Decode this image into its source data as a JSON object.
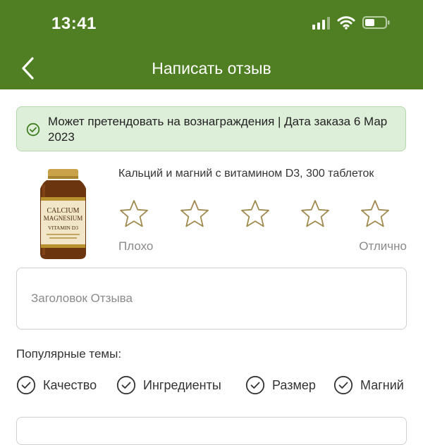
{
  "status_bar": {
    "time": "13:41"
  },
  "header": {
    "title": "Написать отзыв",
    "back_icon": "chevron-left-icon"
  },
  "banner": {
    "text": "Может претендовать на вознаграждения  |  Дата заказа 6 Мар 2023",
    "icon": "check-circle-icon"
  },
  "product": {
    "name": "Кальций и магний с витамином D3, 300 таблеток",
    "label_lines": [
      "CALCIUM",
      "MAGNESIUM",
      "VITAMIN D3"
    ]
  },
  "rating": {
    "low_label": "Плохо",
    "high_label": "Отлично",
    "max_stars": 5,
    "selected": 0
  },
  "review_title": {
    "placeholder": "Заголовок Отзыва",
    "value": ""
  },
  "topics": {
    "label": "Популярные темы:",
    "items": [
      "Качество",
      "Ингредиенты",
      "Размер",
      "Магний"
    ]
  },
  "colors": {
    "header_bg": "#4f7f22",
    "banner_bg": "#deefd9",
    "star_outline": "#a08a4f"
  }
}
